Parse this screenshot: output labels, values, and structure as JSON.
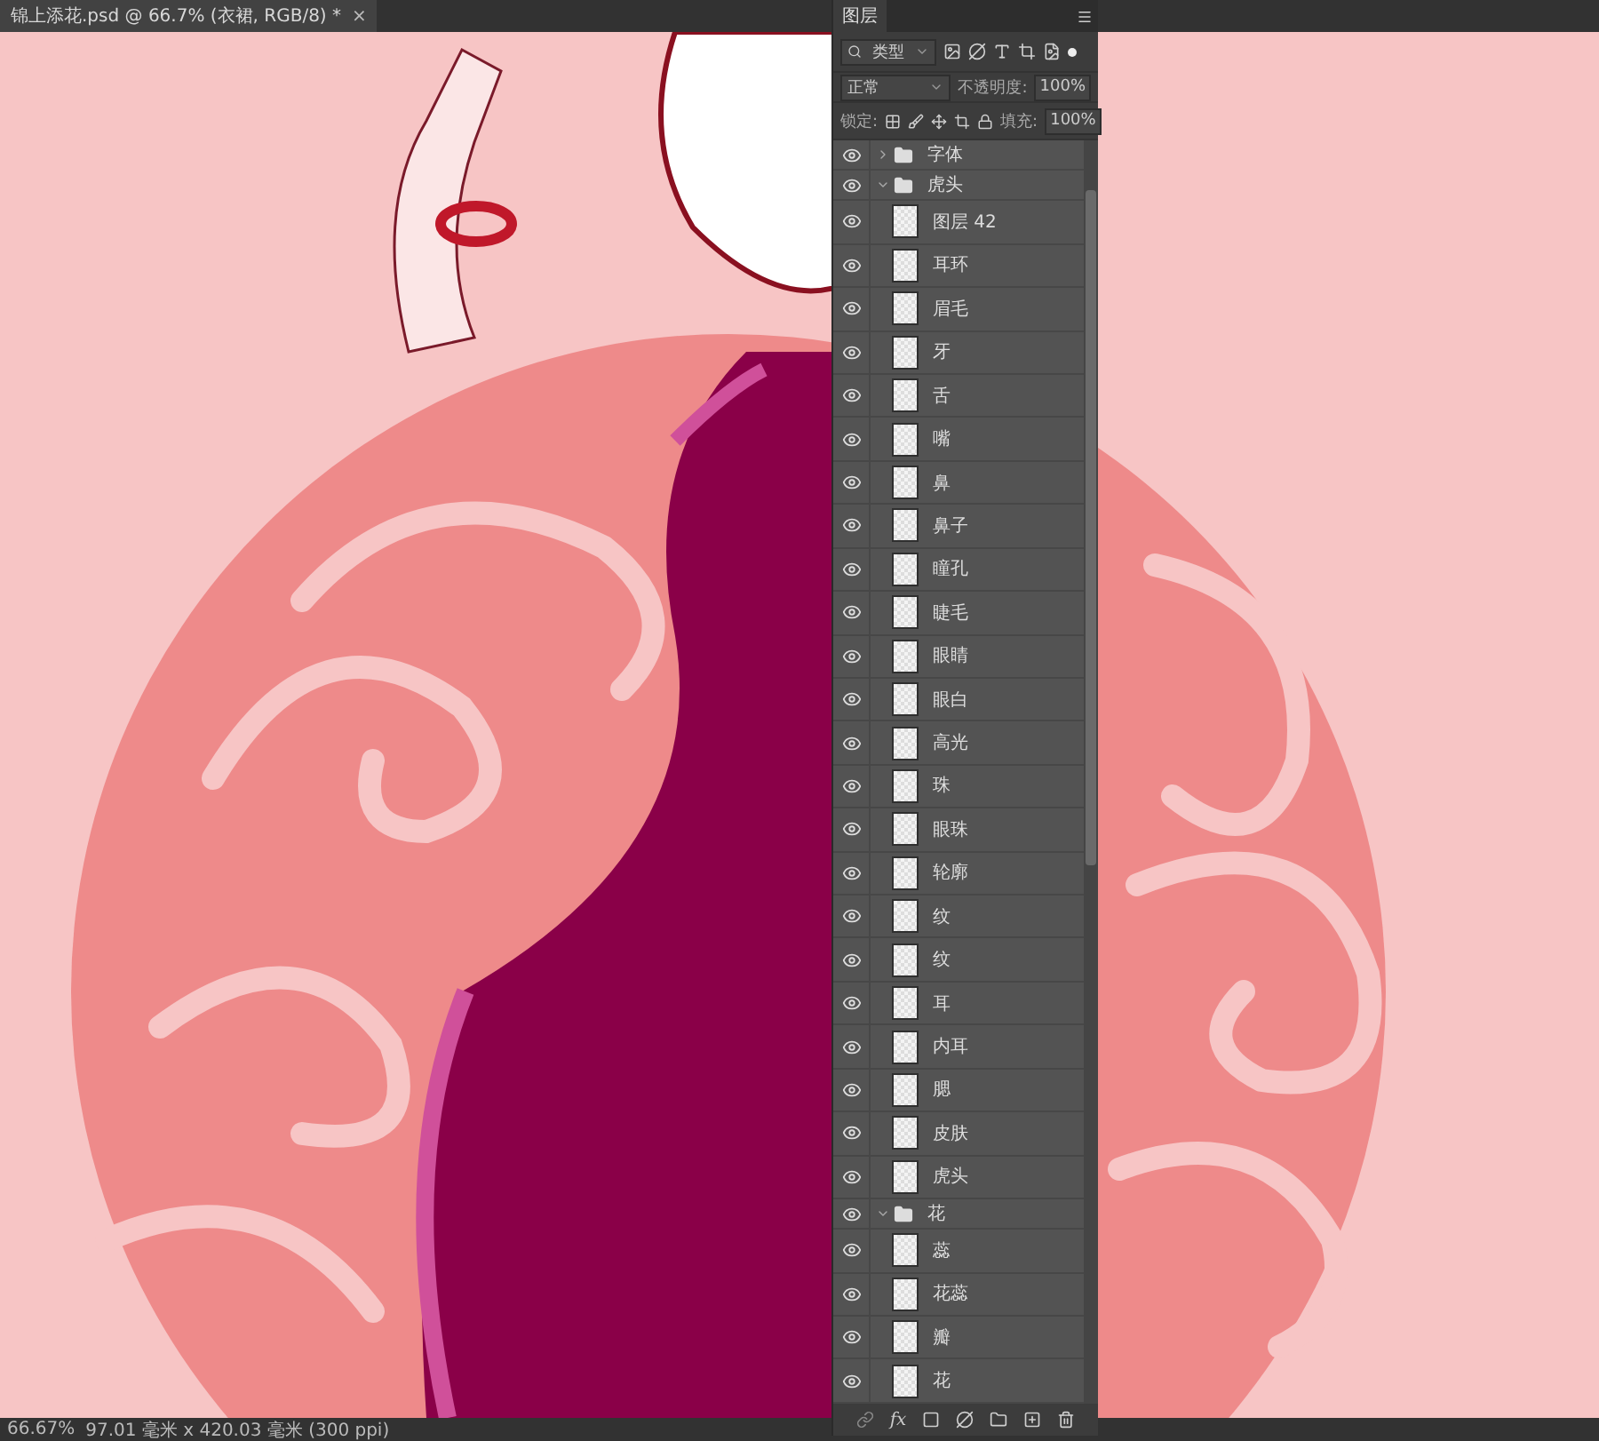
{
  "document_tab": {
    "title": "锦上添花.psd @ 66.7% (衣裙, RGB/8) *",
    "close": "×",
    "selected": true
  },
  "layers_panel": {
    "tab": "图层",
    "filter": "类型",
    "blend_mode": "正常",
    "opacity_label": "不透明度:",
    "opacity": "100%",
    "lock_label": "锁定:",
    "fill_label": "填充:",
    "fill": "100%",
    "effects_button": "fx",
    "layers": [
      {
        "kind": "group",
        "name": "字体",
        "visible": true,
        "expanded": false
      },
      {
        "kind": "group",
        "name": "虎头",
        "visible": true,
        "expanded": true,
        "children": [
          {
            "kind": "layer",
            "name": "图层 42",
            "visible": true
          },
          {
            "kind": "layer",
            "name": "耳环",
            "visible": true
          },
          {
            "kind": "layer",
            "name": "眉毛",
            "visible": true
          },
          {
            "kind": "layer",
            "name": "牙",
            "visible": true
          },
          {
            "kind": "layer",
            "name": "舌",
            "visible": true
          },
          {
            "kind": "layer",
            "name": "嘴",
            "visible": true
          },
          {
            "kind": "layer",
            "name": "鼻",
            "visible": true
          },
          {
            "kind": "layer",
            "name": "鼻子",
            "visible": true
          },
          {
            "kind": "layer",
            "name": "瞳孔",
            "visible": true
          },
          {
            "kind": "layer",
            "name": "睫毛",
            "visible": true
          },
          {
            "kind": "layer",
            "name": "眼睛",
            "visible": true
          },
          {
            "kind": "layer",
            "name": "眼白",
            "visible": true
          },
          {
            "kind": "layer",
            "name": "高光",
            "visible": true
          },
          {
            "kind": "layer",
            "name": "珠",
            "visible": true
          },
          {
            "kind": "layer",
            "name": "眼珠",
            "visible": true
          },
          {
            "kind": "layer",
            "name": "轮廓",
            "visible": true
          },
          {
            "kind": "layer",
            "name": "纹",
            "visible": true
          },
          {
            "kind": "layer",
            "name": "纹",
            "visible": true
          },
          {
            "kind": "layer",
            "name": "耳",
            "visible": true
          },
          {
            "kind": "layer",
            "name": "内耳",
            "visible": true
          },
          {
            "kind": "layer",
            "name": "腮",
            "visible": true
          },
          {
            "kind": "layer",
            "name": "皮肤",
            "visible": true
          },
          {
            "kind": "layer",
            "name": "虎头",
            "visible": true
          }
        ]
      },
      {
        "kind": "group",
        "name": "花",
        "visible": true,
        "expanded": true,
        "children": [
          {
            "kind": "layer",
            "name": "蕊",
            "visible": true
          },
          {
            "kind": "layer",
            "name": "花蕊",
            "visible": true
          },
          {
            "kind": "layer",
            "name": "瓣",
            "visible": true
          },
          {
            "kind": "layer",
            "name": "花",
            "visible": true
          }
        ]
      }
    ]
  },
  "status_bar": {
    "zoom": "66.67%",
    "document_size": "97.01 毫米 x 420.03 毫米 (300 ppi)"
  }
}
